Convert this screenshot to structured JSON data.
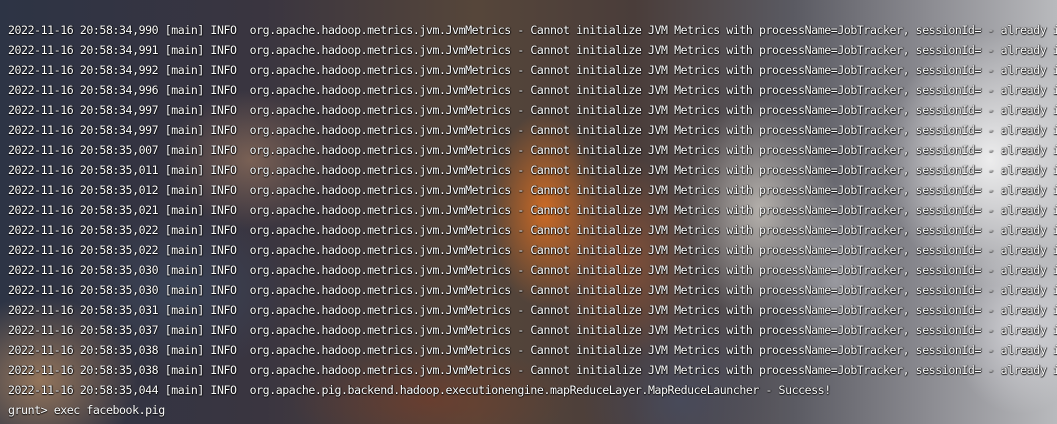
{
  "terminal": {
    "lines": [
      "2022-11-16 20:58:34,990 [main] INFO  org.apache.hadoop.metrics.jvm.JvmMetrics - Cannot initialize JVM Metrics with processName=JobTracker, sessionId= - already initialized",
      "2022-11-16 20:58:34,991 [main] INFO  org.apache.hadoop.metrics.jvm.JvmMetrics - Cannot initialize JVM Metrics with processName=JobTracker, sessionId= - already initialized",
      "2022-11-16 20:58:34,992 [main] INFO  org.apache.hadoop.metrics.jvm.JvmMetrics - Cannot initialize JVM Metrics with processName=JobTracker, sessionId= - already initialized",
      "2022-11-16 20:58:34,996 [main] INFO  org.apache.hadoop.metrics.jvm.JvmMetrics - Cannot initialize JVM Metrics with processName=JobTracker, sessionId= - already initialized",
      "2022-11-16 20:58:34,997 [main] INFO  org.apache.hadoop.metrics.jvm.JvmMetrics - Cannot initialize JVM Metrics with processName=JobTracker, sessionId= - already initialized",
      "2022-11-16 20:58:34,997 [main] INFO  org.apache.hadoop.metrics.jvm.JvmMetrics - Cannot initialize JVM Metrics with processName=JobTracker, sessionId= - already initialized",
      "2022-11-16 20:58:35,007 [main] INFO  org.apache.hadoop.metrics.jvm.JvmMetrics - Cannot initialize JVM Metrics with processName=JobTracker, sessionId= - already initialized",
      "2022-11-16 20:58:35,011 [main] INFO  org.apache.hadoop.metrics.jvm.JvmMetrics - Cannot initialize JVM Metrics with processName=JobTracker, sessionId= - already initialized",
      "2022-11-16 20:58:35,012 [main] INFO  org.apache.hadoop.metrics.jvm.JvmMetrics - Cannot initialize JVM Metrics with processName=JobTracker, sessionId= - already initialized",
      "2022-11-16 20:58:35,021 [main] INFO  org.apache.hadoop.metrics.jvm.JvmMetrics - Cannot initialize JVM Metrics with processName=JobTracker, sessionId= - already initialized",
      "2022-11-16 20:58:35,022 [main] INFO  org.apache.hadoop.metrics.jvm.JvmMetrics - Cannot initialize JVM Metrics with processName=JobTracker, sessionId= - already initialized",
      "2022-11-16 20:58:35,022 [main] INFO  org.apache.hadoop.metrics.jvm.JvmMetrics - Cannot initialize JVM Metrics with processName=JobTracker, sessionId= - already initialized",
      "2022-11-16 20:58:35,030 [main] INFO  org.apache.hadoop.metrics.jvm.JvmMetrics - Cannot initialize JVM Metrics with processName=JobTracker, sessionId= - already initialized",
      "2022-11-16 20:58:35,030 [main] INFO  org.apache.hadoop.metrics.jvm.JvmMetrics - Cannot initialize JVM Metrics with processName=JobTracker, sessionId= - already initialized",
      "2022-11-16 20:58:35,031 [main] INFO  org.apache.hadoop.metrics.jvm.JvmMetrics - Cannot initialize JVM Metrics with processName=JobTracker, sessionId= - already initialized",
      "2022-11-16 20:58:35,037 [main] INFO  org.apache.hadoop.metrics.jvm.JvmMetrics - Cannot initialize JVM Metrics with processName=JobTracker, sessionId= - already initialized",
      "2022-11-16 20:58:35,038 [main] INFO  org.apache.hadoop.metrics.jvm.JvmMetrics - Cannot initialize JVM Metrics with processName=JobTracker, sessionId= - already initialized",
      "2022-11-16 20:58:35,038 [main] INFO  org.apache.hadoop.metrics.jvm.JvmMetrics - Cannot initialize JVM Metrics with processName=JobTracker, sessionId= - already initialized",
      "2022-11-16 20:58:35,044 [main] INFO  org.apache.pig.backend.hadoop.executionengine.mapReduceLayer.MapReduceLauncher - Success!"
    ],
    "prompt": "grunt> exec facebook.pig"
  }
}
